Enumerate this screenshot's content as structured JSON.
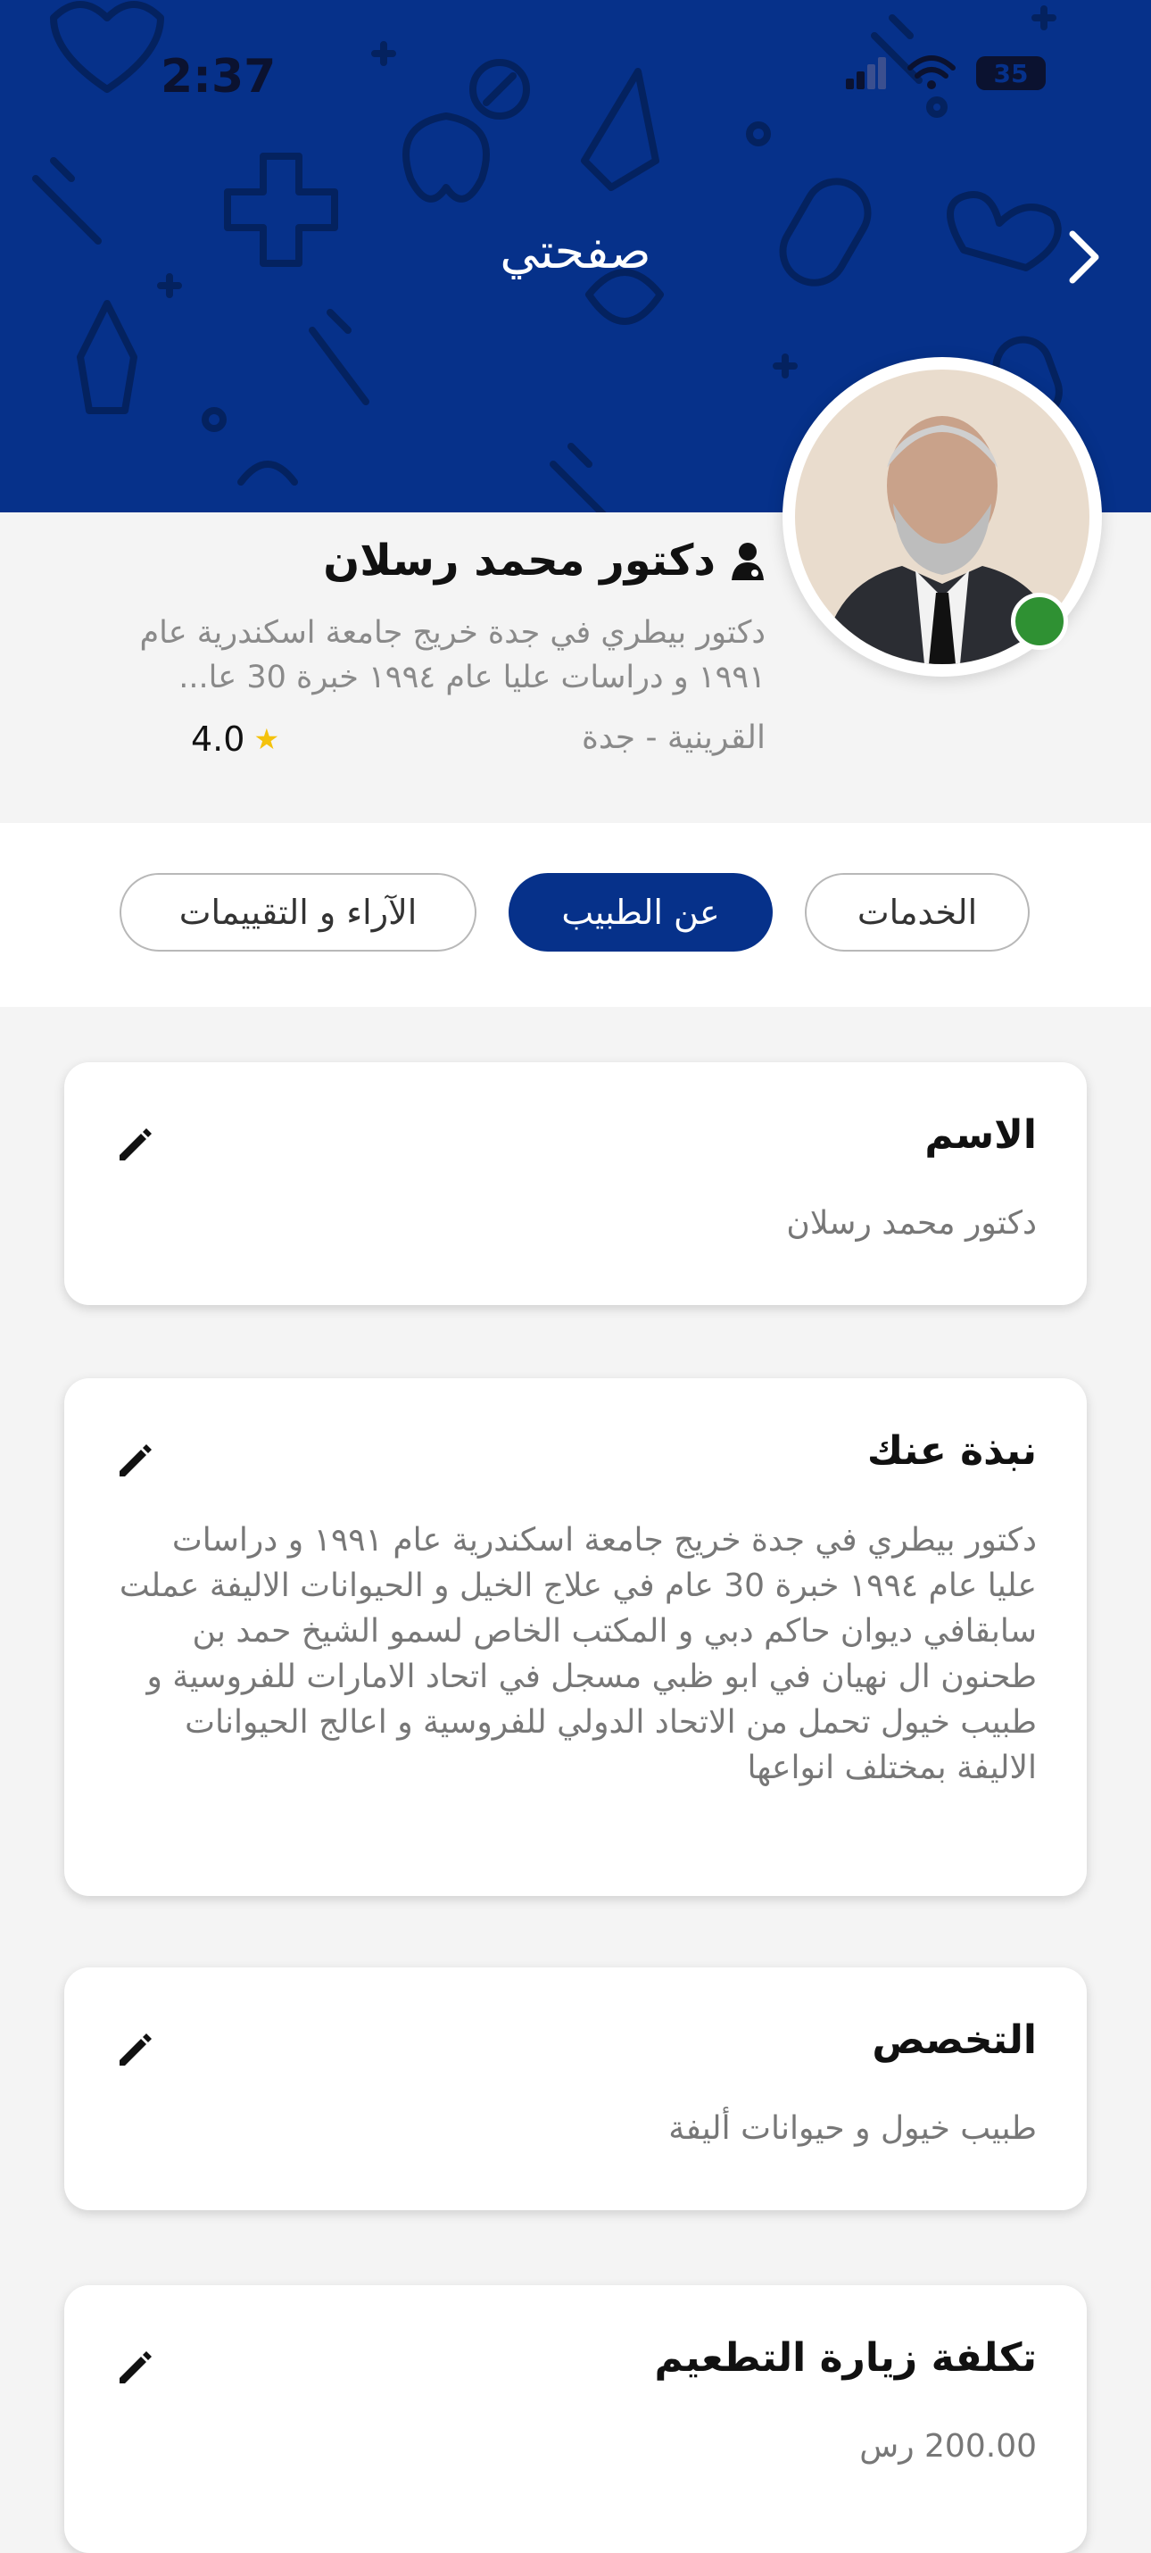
{
  "status_bar": {
    "time": "2:37",
    "battery": "35"
  },
  "header": {
    "title": "صفحتي"
  },
  "profile": {
    "name": "دكتور محمد رسلان",
    "bio": "دكتور بيطري في جدة خريج جامعة اسكندرية عام ١٩٩١ و دراسات عليا عام ١٩٩٤ خبرة 30 عا...",
    "location": "القرينية - جدة",
    "rating": "4.0"
  },
  "tabs": [
    {
      "label": "الخدمات",
      "active": false
    },
    {
      "label": "عن الطبيب",
      "active": true
    },
    {
      "label": "الآراء و التقييمات",
      "active": false
    }
  ],
  "cards": {
    "name": {
      "title": "الاسم",
      "value": "دكتور محمد رسلان"
    },
    "about": {
      "title": "نبذة عنك",
      "value": "دكتور بيطري في جدة خريج جامعة اسكندرية عام ١٩٩١ و دراسات عليا عام ١٩٩٤ خبرة 30 عام في علاج الخيل و الحيوانات الاليفة عملت سابقافي ديوان حاكم دبي و المكتب الخاص لسمو الشيخ حمد بن طحنون ال نهيان في ابو ظبي مسجل في اتحاد الامارات للفروسية و طبيب خيول تحمل من الاتحاد الدولي للفروسية و اعالج الحيوانات الاليفة بمختلف انواعها"
    },
    "specialty": {
      "title": "التخصص",
      "value": "طبيب خيول و حيوانات أليفة"
    },
    "vaccination_cost": {
      "title": "تكلفة زيارة التطعيم",
      "value": "200.00 رس"
    }
  },
  "colors": {
    "primary": "#06318a",
    "online": "#2f9133",
    "star": "#f4c20d"
  }
}
